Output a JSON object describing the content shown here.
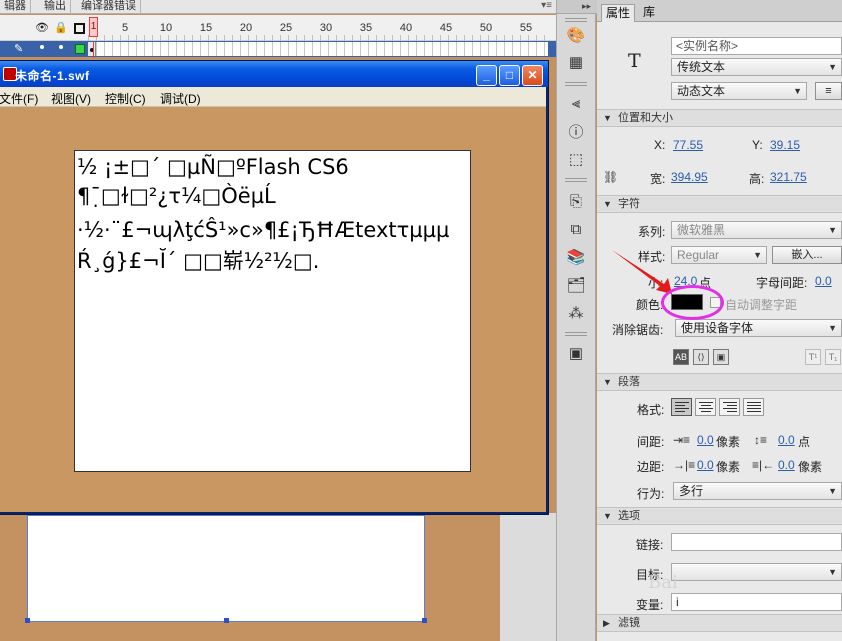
{
  "timeline": {
    "tabs": [
      "辑器",
      "输出",
      "编译器错误"
    ],
    "frame_numbers": [
      "1",
      "5",
      "10",
      "15",
      "20",
      "25",
      "30",
      "35",
      "40",
      "45",
      "50",
      "55"
    ],
    "playhead_frame": "1"
  },
  "swf_window": {
    "title": "未命名-1.swf",
    "menu": [
      "文件(F)",
      "视图(V)",
      "控制(C)",
      "调试(D)"
    ],
    "buttons": {
      "minimize": "_",
      "maximize": "□",
      "close": "✕"
    },
    "text_lines": [
      "½ ¡±□´ □µÑ□ºFlash CS6",
      "¶¯̣□ɫ□²¿τ¼□ÒëµĹ",
      "·½·¨£¬ɰλţćŜ¹»c»¶£¡ЂĦÆtextτµµµ",
      "Ŕ¸ǵ}£¬Ĭ´ □□崭½²½□."
    ]
  },
  "props_panel": {
    "tabs": [
      "属性",
      "库"
    ],
    "instance_name_placeholder": "<实例名称>",
    "text_type": "传统文本",
    "text_behavior": "动态文本",
    "text_tool_glyph": "T",
    "sections": {
      "position": "位置和大小",
      "character": "字符",
      "paragraph": "段落",
      "options": "选项",
      "filters": "滤镜"
    },
    "position": {
      "x_label": "X:",
      "x_value": "77.55",
      "y_label": "Y:",
      "y_value": "39.15",
      "w_label": "宽:",
      "w_value": "394.95",
      "h_label": "高:",
      "h_value": "321.75"
    },
    "character": {
      "family_label": "系列:",
      "family_value": "微软雅黑",
      "style_label": "样式:",
      "style_value": "Regular",
      "embed_button": "嵌入...",
      "size_label": "小:",
      "size_value": "24.0",
      "size_unit": "点",
      "spacing_label": "字母间距:",
      "spacing_value": "0.0",
      "color_label": "颜色:",
      "color_value": "#000000",
      "auto_kern_label": "自动调整字距",
      "antialias_label": "消除锯齿:",
      "antialias_value": "使用设备字体"
    },
    "paragraph": {
      "format_label": "格式:",
      "gap_label": "间距:",
      "indent_value": "0.0",
      "indent_unit": "像素",
      "line_spacing_value": "0.0",
      "line_spacing_unit": "点",
      "margin_label": "边距:",
      "left_margin_value": "0.0",
      "left_margin_unit": "像素",
      "right_margin_value": "0.0",
      "right_margin_unit": "像素",
      "behavior_label": "行为:",
      "behavior_value": "多行"
    },
    "options": {
      "link_label": "链接:",
      "target_label": "目标:",
      "variable_label": "变量:",
      "variable_value": "i"
    }
  },
  "watermark": "Bai"
}
